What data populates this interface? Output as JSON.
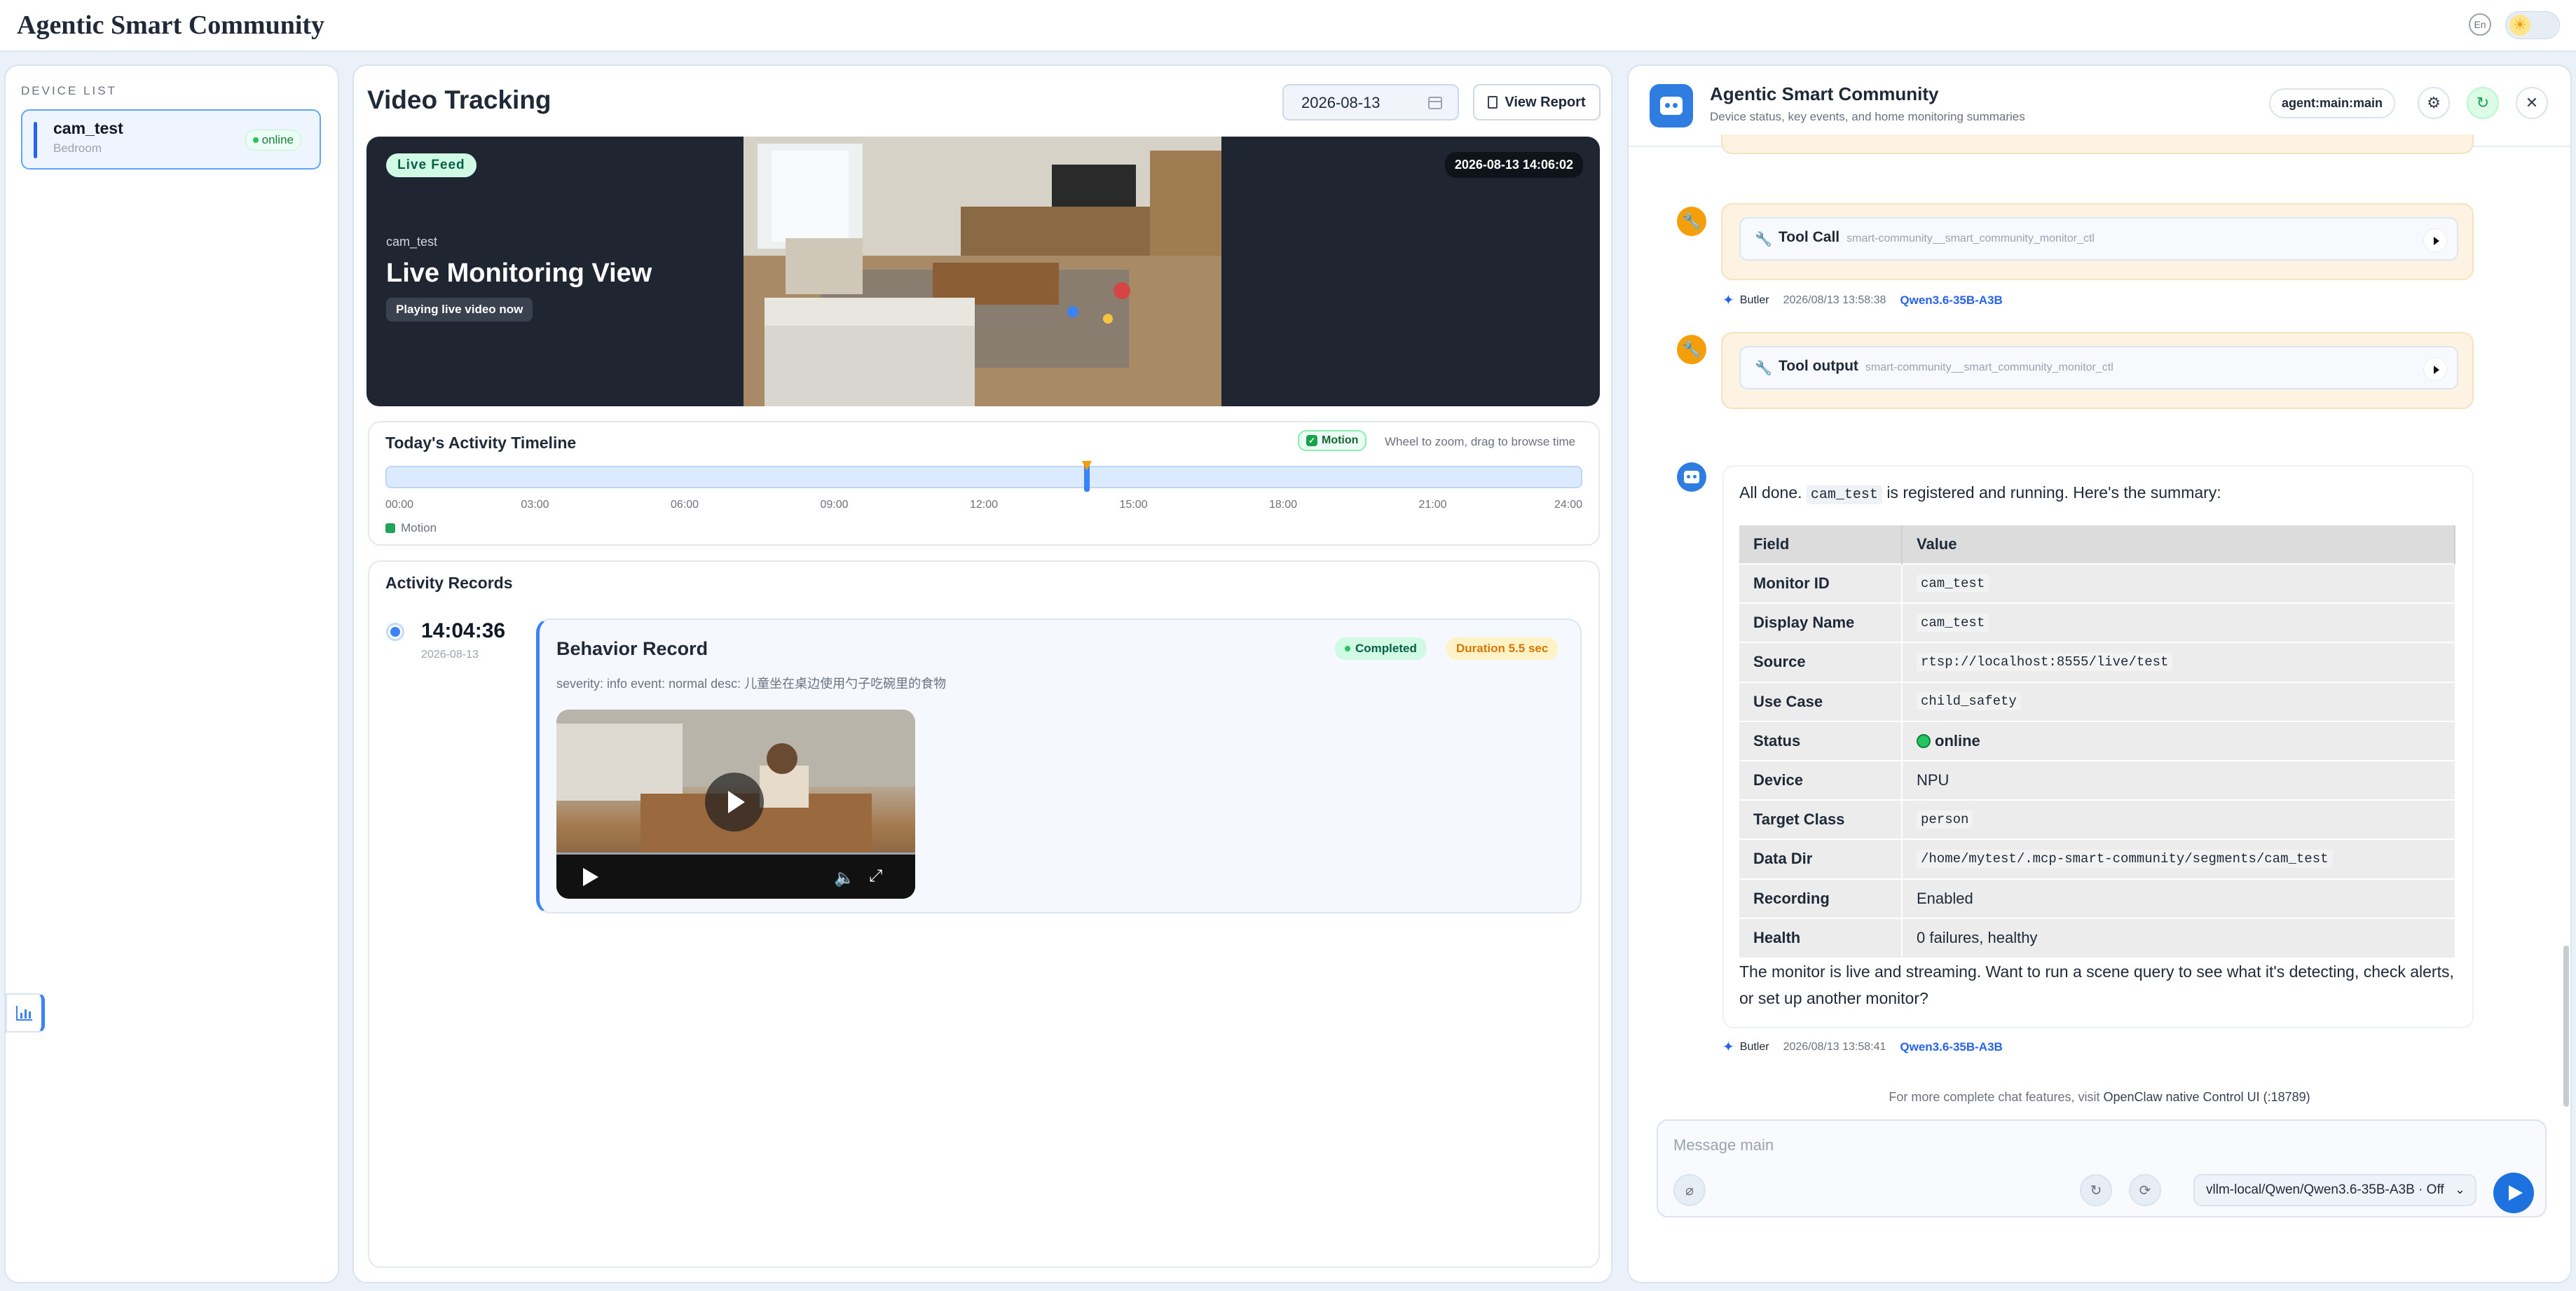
{
  "header": {
    "title": "Agentic Smart Community",
    "lang": "En"
  },
  "sidebar": {
    "section_label": "DEVICE LIST",
    "devices": [
      {
        "name": "cam_test",
        "room": "Bedroom",
        "status": "online"
      }
    ]
  },
  "center": {
    "title": "Video Tracking",
    "date": "2026-08-13",
    "report_button": "View Report",
    "live": {
      "badge": "Live Feed",
      "timestamp": "2026-08-13 14:06:02",
      "camera": "cam_test",
      "title": "Live Monitoring View",
      "state": "Playing live video now"
    },
    "timeline": {
      "title": "Today's Activity Timeline",
      "filter": "Motion",
      "hint": "Wheel to zoom, drag to browse time",
      "ticks": [
        "00:00",
        "03:00",
        "06:00",
        "09:00",
        "12:00",
        "15:00",
        "18:00",
        "21:00",
        "24:00"
      ],
      "legend": "Motion",
      "motion_event_fraction": 0.586
    },
    "records": {
      "title": "Activity Records",
      "items": [
        {
          "time": "14:04:36",
          "date": "2026-08-13",
          "heading": "Behavior Record",
          "status": "Completed",
          "duration": "Duration 5.5 sec",
          "desc": "severity: info event: normal desc: 儿童坐在桌边使用勺子吃碗里的食物"
        }
      ]
    }
  },
  "chat": {
    "title": "Agentic Smart Community",
    "subtitle": "Device status, key events, and home monitoring summaries",
    "agent": "agent:main:main",
    "tool_call": {
      "label": "Tool Call",
      "name": "smart-community__smart_community_monitor_ctl"
    },
    "tool_output": {
      "label": "Tool output",
      "name": "smart-community__smart_community_monitor_ctl"
    },
    "meta1": {
      "sender": "Butler",
      "time": "2026/08/13 13:58:38",
      "model": "Qwen3.6-35B-A3B"
    },
    "message": {
      "intro_pre": "All done.",
      "intro_code": "cam_test",
      "intro_post": "is registered and running. Here's the summary:",
      "table_headers": [
        "Field",
        "Value"
      ],
      "rows": [
        {
          "field": "Monitor ID",
          "value": "cam_test",
          "mono": true
        },
        {
          "field": "Display Name",
          "value": "cam_test",
          "mono": true
        },
        {
          "field": "Source",
          "value": "rtsp://localhost:8555/live/test",
          "mono": true
        },
        {
          "field": "Use Case",
          "value": "child_safety",
          "mono": true
        },
        {
          "field": "Status",
          "value": "online",
          "mono": false,
          "dot": true
        },
        {
          "field": "Device",
          "value": "NPU",
          "mono": false
        },
        {
          "field": "Target Class",
          "value": "person",
          "mono": true
        },
        {
          "field": "Data Dir",
          "value": "/home/mytest/.mcp-smart-community/segments/cam_test",
          "mono": true
        },
        {
          "field": "Recording",
          "value": "Enabled",
          "mono": false
        },
        {
          "field": "Health",
          "value": "0 failures, healthy",
          "mono": false
        }
      ],
      "outro": "The monitor is live and streaming. Want to run a scene query to see what it's detecting, check alerts, or set up another monitor?"
    },
    "meta2": {
      "sender": "Butler",
      "time": "2026/08/13 13:58:41",
      "model": "Qwen3.6-35B-A3B"
    },
    "footnote_pre": "For more complete chat features, visit",
    "footnote_link": "OpenClaw native Control UI (:18789)",
    "input_placeholder": "Message main",
    "model_select": "vllm-local/Qwen/Qwen3.6-35B-A3B · Off"
  }
}
